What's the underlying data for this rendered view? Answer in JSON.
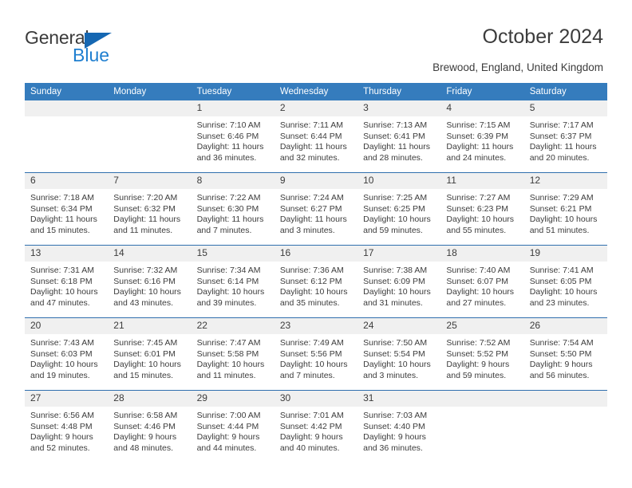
{
  "brand": {
    "name_part1": "General",
    "name_part2": "Blue",
    "logo_icon": "triangle-flag-icon"
  },
  "header": {
    "title": "October 2024",
    "location": "Brewood, England, United Kingdom"
  },
  "colors": {
    "header_blue": "#357cbd",
    "row_separator_blue": "#2f6fae",
    "daynum_band": "#f0f0f0",
    "brand_blue": "#1f7fd0",
    "text": "#3c3c3c"
  },
  "calendar": {
    "weekday_headers": [
      "Sunday",
      "Monday",
      "Tuesday",
      "Wednesday",
      "Thursday",
      "Friday",
      "Saturday"
    ],
    "labels": {
      "sunrise": "Sunrise:",
      "sunset": "Sunset:",
      "daylight": "Daylight:"
    },
    "weeks": [
      [
        {
          "empty": true
        },
        {
          "empty": true
        },
        {
          "day": "1",
          "sunrise": "Sunrise: 7:10 AM",
          "sunset": "Sunset: 6:46 PM",
          "daylight1": "Daylight: 11 hours",
          "daylight2": "and 36 minutes."
        },
        {
          "day": "2",
          "sunrise": "Sunrise: 7:11 AM",
          "sunset": "Sunset: 6:44 PM",
          "daylight1": "Daylight: 11 hours",
          "daylight2": "and 32 minutes."
        },
        {
          "day": "3",
          "sunrise": "Sunrise: 7:13 AM",
          "sunset": "Sunset: 6:41 PM",
          "daylight1": "Daylight: 11 hours",
          "daylight2": "and 28 minutes."
        },
        {
          "day": "4",
          "sunrise": "Sunrise: 7:15 AM",
          "sunset": "Sunset: 6:39 PM",
          "daylight1": "Daylight: 11 hours",
          "daylight2": "and 24 minutes."
        },
        {
          "day": "5",
          "sunrise": "Sunrise: 7:17 AM",
          "sunset": "Sunset: 6:37 PM",
          "daylight1": "Daylight: 11 hours",
          "daylight2": "and 20 minutes."
        }
      ],
      [
        {
          "day": "6",
          "sunrise": "Sunrise: 7:18 AM",
          "sunset": "Sunset: 6:34 PM",
          "daylight1": "Daylight: 11 hours",
          "daylight2": "and 15 minutes."
        },
        {
          "day": "7",
          "sunrise": "Sunrise: 7:20 AM",
          "sunset": "Sunset: 6:32 PM",
          "daylight1": "Daylight: 11 hours",
          "daylight2": "and 11 minutes."
        },
        {
          "day": "8",
          "sunrise": "Sunrise: 7:22 AM",
          "sunset": "Sunset: 6:30 PM",
          "daylight1": "Daylight: 11 hours",
          "daylight2": "and 7 minutes."
        },
        {
          "day": "9",
          "sunrise": "Sunrise: 7:24 AM",
          "sunset": "Sunset: 6:27 PM",
          "daylight1": "Daylight: 11 hours",
          "daylight2": "and 3 minutes."
        },
        {
          "day": "10",
          "sunrise": "Sunrise: 7:25 AM",
          "sunset": "Sunset: 6:25 PM",
          "daylight1": "Daylight: 10 hours",
          "daylight2": "and 59 minutes."
        },
        {
          "day": "11",
          "sunrise": "Sunrise: 7:27 AM",
          "sunset": "Sunset: 6:23 PM",
          "daylight1": "Daylight: 10 hours",
          "daylight2": "and 55 minutes."
        },
        {
          "day": "12",
          "sunrise": "Sunrise: 7:29 AM",
          "sunset": "Sunset: 6:21 PM",
          "daylight1": "Daylight: 10 hours",
          "daylight2": "and 51 minutes."
        }
      ],
      [
        {
          "day": "13",
          "sunrise": "Sunrise: 7:31 AM",
          "sunset": "Sunset: 6:18 PM",
          "daylight1": "Daylight: 10 hours",
          "daylight2": "and 47 minutes."
        },
        {
          "day": "14",
          "sunrise": "Sunrise: 7:32 AM",
          "sunset": "Sunset: 6:16 PM",
          "daylight1": "Daylight: 10 hours",
          "daylight2": "and 43 minutes."
        },
        {
          "day": "15",
          "sunrise": "Sunrise: 7:34 AM",
          "sunset": "Sunset: 6:14 PM",
          "daylight1": "Daylight: 10 hours",
          "daylight2": "and 39 minutes."
        },
        {
          "day": "16",
          "sunrise": "Sunrise: 7:36 AM",
          "sunset": "Sunset: 6:12 PM",
          "daylight1": "Daylight: 10 hours",
          "daylight2": "and 35 minutes."
        },
        {
          "day": "17",
          "sunrise": "Sunrise: 7:38 AM",
          "sunset": "Sunset: 6:09 PM",
          "daylight1": "Daylight: 10 hours",
          "daylight2": "and 31 minutes."
        },
        {
          "day": "18",
          "sunrise": "Sunrise: 7:40 AM",
          "sunset": "Sunset: 6:07 PM",
          "daylight1": "Daylight: 10 hours",
          "daylight2": "and 27 minutes."
        },
        {
          "day": "19",
          "sunrise": "Sunrise: 7:41 AM",
          "sunset": "Sunset: 6:05 PM",
          "daylight1": "Daylight: 10 hours",
          "daylight2": "and 23 minutes."
        }
      ],
      [
        {
          "day": "20",
          "sunrise": "Sunrise: 7:43 AM",
          "sunset": "Sunset: 6:03 PM",
          "daylight1": "Daylight: 10 hours",
          "daylight2": "and 19 minutes."
        },
        {
          "day": "21",
          "sunrise": "Sunrise: 7:45 AM",
          "sunset": "Sunset: 6:01 PM",
          "daylight1": "Daylight: 10 hours",
          "daylight2": "and 15 minutes."
        },
        {
          "day": "22",
          "sunrise": "Sunrise: 7:47 AM",
          "sunset": "Sunset: 5:58 PM",
          "daylight1": "Daylight: 10 hours",
          "daylight2": "and 11 minutes."
        },
        {
          "day": "23",
          "sunrise": "Sunrise: 7:49 AM",
          "sunset": "Sunset: 5:56 PM",
          "daylight1": "Daylight: 10 hours",
          "daylight2": "and 7 minutes."
        },
        {
          "day": "24",
          "sunrise": "Sunrise: 7:50 AM",
          "sunset": "Sunset: 5:54 PM",
          "daylight1": "Daylight: 10 hours",
          "daylight2": "and 3 minutes."
        },
        {
          "day": "25",
          "sunrise": "Sunrise: 7:52 AM",
          "sunset": "Sunset: 5:52 PM",
          "daylight1": "Daylight: 9 hours",
          "daylight2": "and 59 minutes."
        },
        {
          "day": "26",
          "sunrise": "Sunrise: 7:54 AM",
          "sunset": "Sunset: 5:50 PM",
          "daylight1": "Daylight: 9 hours",
          "daylight2": "and 56 minutes."
        }
      ],
      [
        {
          "day": "27",
          "sunrise": "Sunrise: 6:56 AM",
          "sunset": "Sunset: 4:48 PM",
          "daylight1": "Daylight: 9 hours",
          "daylight2": "and 52 minutes."
        },
        {
          "day": "28",
          "sunrise": "Sunrise: 6:58 AM",
          "sunset": "Sunset: 4:46 PM",
          "daylight1": "Daylight: 9 hours",
          "daylight2": "and 48 minutes."
        },
        {
          "day": "29",
          "sunrise": "Sunrise: 7:00 AM",
          "sunset": "Sunset: 4:44 PM",
          "daylight1": "Daylight: 9 hours",
          "daylight2": "and 44 minutes."
        },
        {
          "day": "30",
          "sunrise": "Sunrise: 7:01 AM",
          "sunset": "Sunset: 4:42 PM",
          "daylight1": "Daylight: 9 hours",
          "daylight2": "and 40 minutes."
        },
        {
          "day": "31",
          "sunrise": "Sunrise: 7:03 AM",
          "sunset": "Sunset: 4:40 PM",
          "daylight1": "Daylight: 9 hours",
          "daylight2": "and 36 minutes."
        },
        {
          "empty": true
        },
        {
          "empty": true
        }
      ]
    ]
  }
}
